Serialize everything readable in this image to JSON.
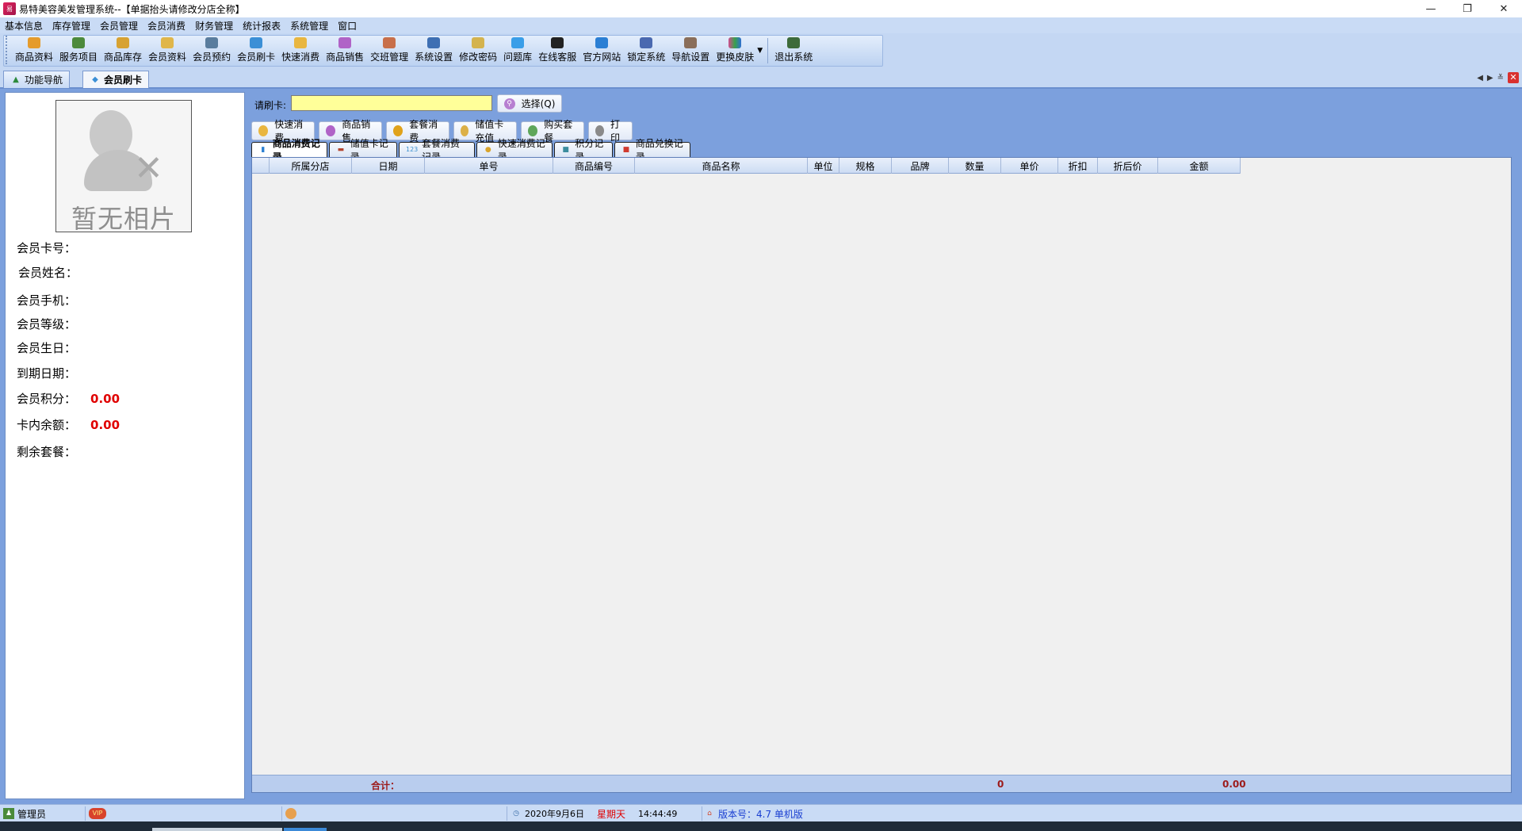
{
  "window": {
    "title": "易特美容美发管理系统--【单据抬头请修改分店全称】",
    "controls": {
      "minimize": "—",
      "restore": "❐",
      "close": "✕"
    }
  },
  "menu": [
    "基本信息",
    "库存管理",
    "会员管理",
    "会员消费",
    "财务管理",
    "统计报表",
    "系统管理",
    "窗口"
  ],
  "toolbar": {
    "buttons": [
      {
        "label": "商品资料",
        "icon": "product-icon",
        "color": "#e59b2c"
      },
      {
        "label": "服务项目",
        "icon": "service-list-icon",
        "color": "#4c8a3c"
      },
      {
        "label": "商品库存",
        "icon": "stock-box-icon",
        "color": "#d7a232"
      },
      {
        "label": "会员资料",
        "icon": "member-icon",
        "color": "#e0b64a"
      },
      {
        "label": "会员预约",
        "icon": "camera-icon",
        "color": "#5a7d9e"
      },
      {
        "label": "会员刷卡",
        "icon": "card-swipe-icon",
        "color": "#3b8fd6"
      },
      {
        "label": "快速消费",
        "icon": "quick-consume-icon",
        "color": "#e9b640"
      },
      {
        "label": "商品销售",
        "icon": "sale-icon",
        "color": "#b063c7"
      },
      {
        "label": "交班管理",
        "icon": "shift-users-icon",
        "color": "#c86f4a"
      },
      {
        "label": "系统设置",
        "icon": "settings-icon",
        "color": "#3e6fb3"
      },
      {
        "label": "修改密码",
        "icon": "key-icon",
        "color": "#d4b34e"
      },
      {
        "label": "问题库",
        "icon": "faq-icon",
        "color": "#3a9ee8"
      },
      {
        "label": "在线客服",
        "icon": "qq-icon",
        "color": "#222222"
      },
      {
        "label": "官方网站",
        "icon": "ie-browser-icon",
        "color": "#2b7fd4"
      },
      {
        "label": "锁定系统",
        "icon": "lock-monitor-icon",
        "color": "#4a69b0"
      },
      {
        "label": "导航设置",
        "icon": "nav-settings-icon",
        "color": "#8a6e5a"
      },
      {
        "label": "更换皮肤",
        "icon": "skin-palette-icon",
        "color": "#d24b8e"
      }
    ],
    "exit_label": "退出系统"
  },
  "doc_tabs": [
    {
      "label": "功能导航",
      "active": false
    },
    {
      "label": "会员刷卡",
      "active": true
    }
  ],
  "member": {
    "photo_placeholder": "暂无相片",
    "fields": [
      {
        "label": "会员卡号：",
        "value": ""
      },
      {
        "label": "会员姓名：",
        "value": ""
      },
      {
        "label": "会员手机：",
        "value": ""
      },
      {
        "label": "会员等级：",
        "value": ""
      },
      {
        "label": "会员生日：",
        "value": ""
      },
      {
        "label": "到期日期：",
        "value": ""
      },
      {
        "label": "会员积分：",
        "value": "0.00"
      },
      {
        "label": "卡内余额：",
        "value": "0.00"
      },
      {
        "label": "剩余套餐：",
        "value": ""
      }
    ]
  },
  "card": {
    "label": "请刷卡:",
    "value": "",
    "select_label": "选择(Q)"
  },
  "actions": [
    "快速消费",
    "商品销售",
    "套餐消费",
    "储值卡充值",
    "购买套餐",
    "打印"
  ],
  "record_tabs": [
    {
      "label": "商品消费记录",
      "active": true
    },
    {
      "label": "储值卡记录",
      "active": false
    },
    {
      "label": "套餐消费记录",
      "active": false
    },
    {
      "label": "快速消费记录",
      "active": false
    },
    {
      "label": "积分记录",
      "active": false
    },
    {
      "label": "商品兑换记录",
      "active": false
    }
  ],
  "grid": {
    "columns": [
      "",
      "所属分店",
      "日期",
      "单号",
      "商品编号",
      "商品名称",
      "单位",
      "规格",
      "品牌",
      "数量",
      "单价",
      "折扣",
      "折后价",
      "金额"
    ],
    "rows": [],
    "footer": {
      "total_label": "合计：",
      "qty_total": "0",
      "amount_total": "0.00"
    }
  },
  "status": {
    "user": "管理员",
    "vip": "VIP",
    "date": "2020年9月6日",
    "weekday": "星期天",
    "time": "14:44:49",
    "version": "版本号：4.7 单机版"
  }
}
